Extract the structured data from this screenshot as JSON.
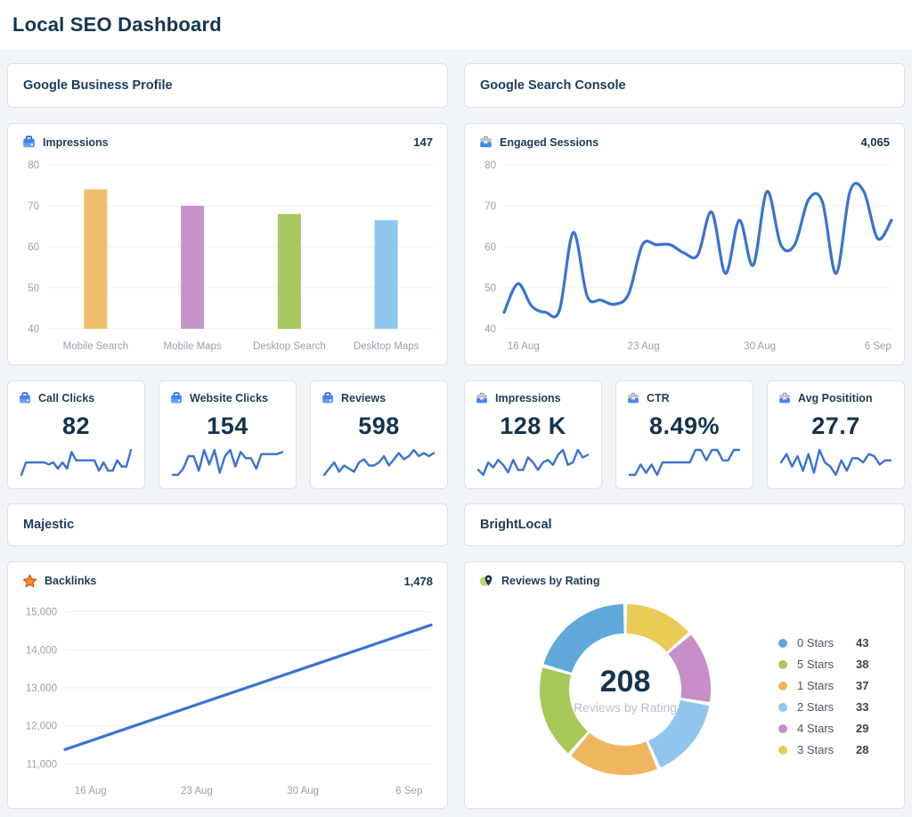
{
  "page": {
    "title": "Local SEO Dashboard"
  },
  "sections": {
    "gbp": "Google Business Profile",
    "gsc": "Google Search Console",
    "majestic": "Majestic",
    "brightlocal": "BrightLocal"
  },
  "kpis": [
    {
      "label": "Call Clicks",
      "value": "82",
      "source_icon": "google-business-profile-icon",
      "spark": [
        1,
        4,
        4,
        4,
        4,
        4,
        3.5,
        4,
        2.5,
        4,
        2.5,
        6.5,
        4.5,
        4.5,
        4.5,
        4.5,
        4.5,
        2,
        4,
        2,
        2,
        4.5,
        3,
        3,
        7
      ]
    },
    {
      "label": "Website Clicks",
      "value": "154",
      "source_icon": "google-business-profile-icon",
      "spark": [
        1,
        1,
        2.5,
        5.5,
        5.5,
        2,
        7,
        3.5,
        7,
        1.5,
        5.5,
        7,
        3,
        6.5,
        5,
        5,
        2.5,
        6,
        6,
        6,
        6,
        6.5
      ]
    },
    {
      "label": "Reviews",
      "value": "598",
      "source_icon": "google-business-profile-icon",
      "spark": [
        2.5,
        3.5,
        4.5,
        3,
        4,
        3.5,
        3,
        4.5,
        5,
        4,
        4,
        4.5,
        5.5,
        4,
        5,
        6,
        5,
        5.5,
        6.5,
        5.5,
        6,
        5.5,
        6
      ]
    },
    {
      "label": "Impressions",
      "value": "128 K",
      "source_icon": "google-search-console-icon",
      "spark": [
        3,
        2,
        4.5,
        3.5,
        5,
        4,
        2.5,
        5,
        3,
        3,
        5.5,
        4.5,
        3,
        4.5,
        5,
        4,
        6,
        7,
        4,
        4.5,
        7,
        5.5,
        6
      ]
    },
    {
      "label": "CTR",
      "value": "8.49%",
      "source_icon": "google-search-console-icon",
      "spark": [
        1,
        1,
        3.5,
        1.5,
        3.5,
        1,
        4,
        4,
        4,
        4,
        4,
        4,
        7,
        7,
        4.5,
        7,
        7,
        4.5,
        4.5,
        7,
        7
      ]
    },
    {
      "label": "Avg Positition",
      "value": "27.7",
      "source_icon": "google-search-console-icon",
      "spark": [
        5,
        7,
        4,
        6.5,
        3,
        7,
        2.5,
        8,
        5,
        4,
        2,
        5.5,
        3,
        6,
        6,
        5,
        7,
        6.5,
        4.5,
        5.5,
        5.5
      ]
    }
  ],
  "chart_data": [
    {
      "type": "bar",
      "title": "Impressions",
      "total": "147",
      "categories": [
        "Mobile Search",
        "Mobile Maps",
        "Desktop Search",
        "Desktop Maps"
      ],
      "values": [
        74,
        70,
        68,
        66.5
      ],
      "colors": [
        "#f0bd69",
        "#c693c8",
        "#aac75f",
        "#8fc6f0"
      ],
      "ylim": [
        40,
        80
      ],
      "yticks": [
        40,
        50,
        60,
        70,
        80
      ],
      "grid": true
    },
    {
      "type": "line",
      "title": "Engaged Sessions",
      "total": "4,065",
      "values": [
        44,
        51,
        45.5,
        44,
        44.5,
        63.5,
        48,
        47,
        46,
        48.5,
        60.5,
        60.5,
        60.5,
        58.5,
        58,
        68.5,
        53.5,
        66.5,
        55.5,
        73.5,
        60.5,
        60.5,
        71.5,
        71,
        53.5,
        73.5,
        73.5,
        62,
        66.5
      ],
      "ylim": [
        40,
        80
      ],
      "yticks": [
        40,
        50,
        60,
        70,
        80
      ],
      "xticks": [
        {
          "label": "16 Aug",
          "frac": 0.05
        },
        {
          "label": "23 Aug",
          "frac": 0.36
        },
        {
          "label": "30 Aug",
          "frac": 0.66
        },
        {
          "label": "6 Sep",
          "frac": 0.965
        }
      ],
      "color": "#3a73d0",
      "smooth": true,
      "grid": true
    },
    {
      "type": "line",
      "title": "Backlinks",
      "total": "1,478",
      "values": [
        11380,
        12470,
        13560,
        14650
      ],
      "ylim": [
        10800,
        15200
      ],
      "yticks": [
        11000,
        12000,
        13000,
        14000,
        15000
      ],
      "xticks": [
        {
          "label": "16 Aug",
          "frac": 0.07
        },
        {
          "label": "23 Aug",
          "frac": 0.36
        },
        {
          "label": "30 Aug",
          "frac": 0.65
        },
        {
          "label": "6 Sep",
          "frac": 0.94
        }
      ],
      "color": "#3a73d0",
      "smooth": false,
      "grid": true
    },
    {
      "type": "donut",
      "title": "Reviews by Rating",
      "center_value": "208",
      "center_label": "Reviews by Rating",
      "segments": [
        {
          "label": "3 Stars",
          "value": 28,
          "color": "#e9cb55"
        },
        {
          "label": "4 Stars",
          "value": 29,
          "color": "#c78dc6"
        },
        {
          "label": "2 Stars",
          "value": 33,
          "color": "#90c6ee"
        },
        {
          "label": "1 Stars",
          "value": 37,
          "color": "#efb65e"
        },
        {
          "label": "5 Stars",
          "value": 38,
          "color": "#a9c85a"
        },
        {
          "label": "0 Stars",
          "value": 43,
          "color": "#5ea9d9"
        }
      ],
      "legend": [
        {
          "label": "0 Stars",
          "value": 43,
          "color": "#5ea9d9"
        },
        {
          "label": "5 Stars",
          "value": 38,
          "color": "#a9c85a"
        },
        {
          "label": "1 Stars",
          "value": 37,
          "color": "#efb65e"
        },
        {
          "label": "2 Stars",
          "value": 33,
          "color": "#90c6ee"
        },
        {
          "label": "4 Stars",
          "value": 29,
          "color": "#c78dc6"
        },
        {
          "label": "3 Stars",
          "value": 28,
          "color": "#e9cb55"
        }
      ],
      "legend_position": "right"
    }
  ],
  "colors": {
    "accent_blue": "#3a73d0",
    "navy_text": "#16344f",
    "axis_gray": "#98a1a8",
    "grid_gray": "#edf0f2",
    "background": "#f2f5f7",
    "card_border": "#dbe2e8",
    "majestic_star": "#f59120",
    "brightlocal_green": "#b9d86d"
  }
}
